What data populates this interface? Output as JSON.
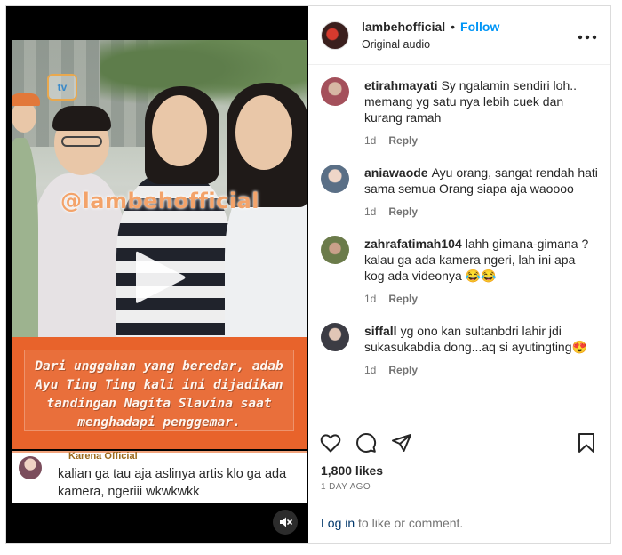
{
  "video": {
    "watermark": "@lambehofficial",
    "caption": "Dari unggahan yang beredar, adab Ayu Ting Ting kali ini dijadikan tandingan Nagita Slavina saat menghadapi penggemar.",
    "comment_card": {
      "name": "Karena Official",
      "text": "kalian ga tau aja aslinya artis klo ga ada kamera, ngeriii wkwkwkk"
    },
    "play_icon": "play-icon",
    "mute_icon": "muted-speaker-icon"
  },
  "header": {
    "username": "lambehofficial",
    "separator": "•",
    "follow_label": "Follow",
    "audio": "Original audio",
    "more_icon": "more-horizontal-icon"
  },
  "comments": [
    {
      "user": "etirahmayati",
      "text": "Sy ngalamin sendiri loh.. memang yg satu nya lebih cuek dan kurang ramah",
      "time": "1d",
      "reply": "Reply",
      "avatar_color": "#a4505b"
    },
    {
      "user": "aniawaode",
      "text": "Ayu orang, sangat rendah hati sama semua Orang siapa aja waoooo",
      "time": "1d",
      "reply": "Reply",
      "avatar_color": "#5a6f86"
    },
    {
      "user": "zahrafatimah104",
      "text": "lahh gimana-gimana ? kalau ga ada kamera ngeri, lah ini apa kog ada videonya 😂😂",
      "time": "1d",
      "reply": "Reply",
      "avatar_color": "#6b7b4a"
    },
    {
      "user": "siffall",
      "text": "yg ono kan sultanbdri lahir jdi sukasukabdia dong...aq si ayutingting😍",
      "time": "1d",
      "reply": "Reply",
      "avatar_color": "#3c3c44"
    }
  ],
  "actions": {
    "like_icon": "heart-icon",
    "comment_icon": "comment-icon",
    "share_icon": "paper-plane-icon",
    "save_icon": "bookmark-icon"
  },
  "likes": "1,800 likes",
  "date": "1 DAY AGO",
  "login": {
    "link": "Log in",
    "rest": " to like or comment."
  }
}
